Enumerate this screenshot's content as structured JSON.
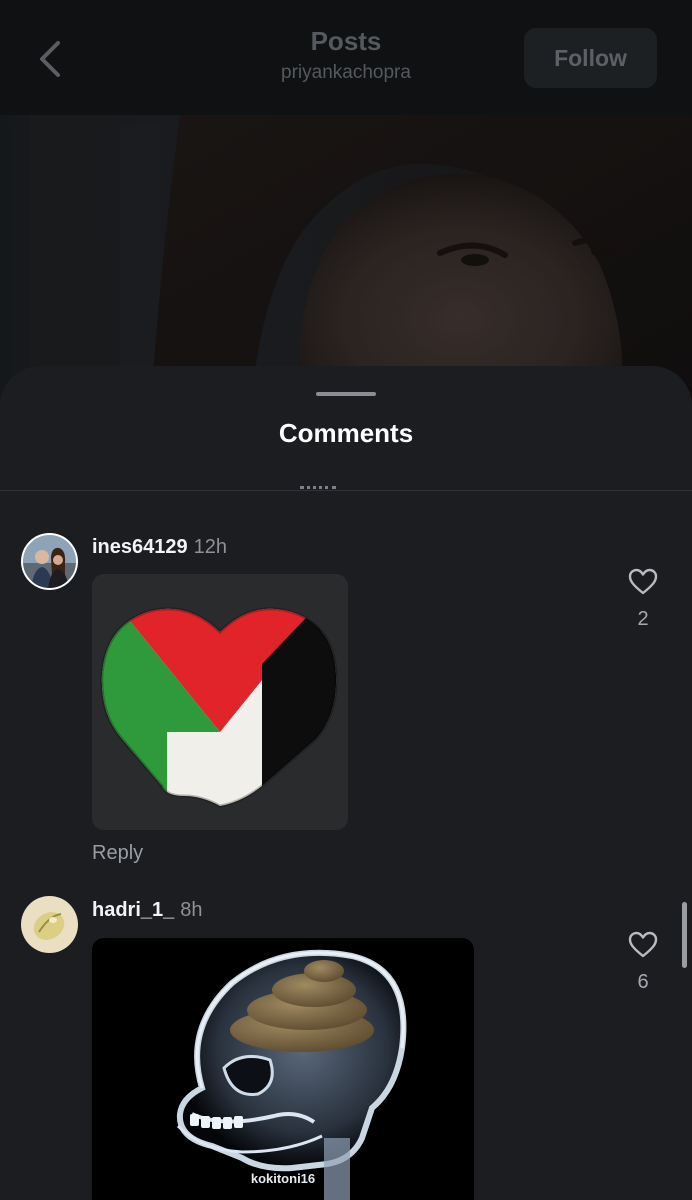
{
  "header": {
    "title": "Posts",
    "username": "priyankachopra",
    "follow_label": "Follow"
  },
  "sheet": {
    "title": "Comments"
  },
  "comments": [
    {
      "username": "ines64129",
      "time": "12h",
      "image_icon": "palestine-flag-heart",
      "reply_label": "Reply",
      "likes": "2"
    },
    {
      "username": "hadri_1_",
      "time": "8h",
      "image_icon": "xray-skull-meme",
      "image_watermark": "kokitoni16",
      "likes": "6"
    }
  ],
  "colors": {
    "sheet_bg": "#1b1d20",
    "header_bg": "#0f1113",
    "text_primary": "#ffffff",
    "text_secondary": "#8e9297"
  }
}
